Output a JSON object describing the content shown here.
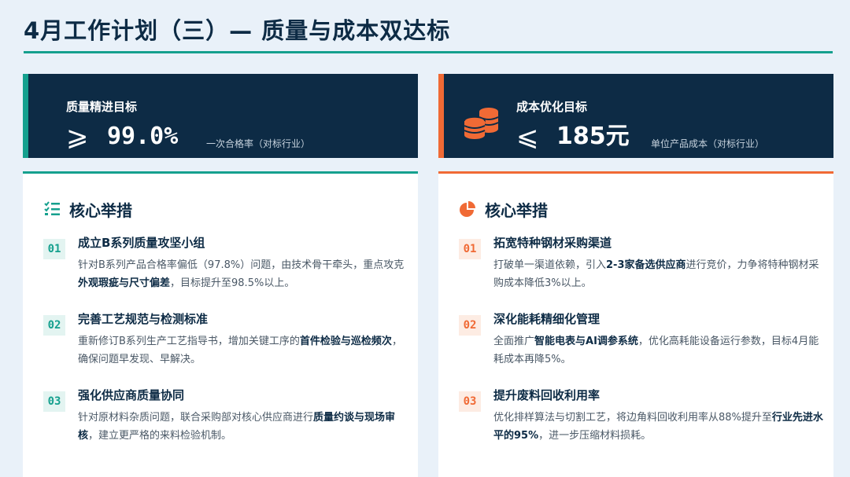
{
  "title": "4月工作计划（三）— 质量与成本双达标",
  "colors": {
    "navy": "#0d2b45",
    "teal": "#15a08e",
    "orange": "#f06a35",
    "bg": "#e9f1f9"
  },
  "quality": {
    "label": "质量精进目标",
    "sign": "⩾",
    "value": "99.0%",
    "desc": "一次合格率（对标行业）",
    "section_title": "核心举措",
    "section_icon": "checklist-icon",
    "items": [
      {
        "num": "01",
        "title": "成立B系列质量攻坚小组",
        "text_parts": [
          "针对B系列产品合格率偏低（97.8%）问题，由技术骨干牵头，重点攻克",
          "外观瑕疵与尺寸偏差",
          "，目标提升至98.5%以上。"
        ]
      },
      {
        "num": "02",
        "title": "完善工艺规范与检测标准",
        "text_parts": [
          "重新修订B系列生产工艺指导书，增加关键工序的",
          "首件检验与巡检频次",
          "，确保问题早发现、早解决。"
        ]
      },
      {
        "num": "03",
        "title": "强化供应商质量协同",
        "text_parts": [
          "针对原材料杂质问题，联合采购部对核心供应商进行",
          "质量约谈与现场审核",
          "，建立更严格的来料检验机制。"
        ]
      }
    ]
  },
  "cost": {
    "label": "成本优化目标",
    "sign": "⩽",
    "value": "185元",
    "desc": "单位产品成本（对标行业）",
    "banner_icon": "coins-icon",
    "section_title": "核心举措",
    "section_icon": "pie-chart-icon",
    "items": [
      {
        "num": "01",
        "title": "拓宽特种钢材采购渠道",
        "text_parts": [
          "打破单一渠道依赖，引入",
          "2-3家备选供应商",
          "进行竞价，力争将特种钢材采购成本降低3%以上。"
        ]
      },
      {
        "num": "02",
        "title": "深化能耗精细化管理",
        "text_parts": [
          "全面推广",
          "智能电表与AI调参系统",
          "，优化高耗能设备运行参数，目标4月能耗成本再降5%。"
        ]
      },
      {
        "num": "03",
        "title": "提升废料回收利用率",
        "text_parts": [
          "优化排样算法与切割工艺，将边角料回收利用率从88%提升至",
          "行业先进水平的95%",
          "，进一步压缩材料损耗。"
        ]
      }
    ]
  }
}
